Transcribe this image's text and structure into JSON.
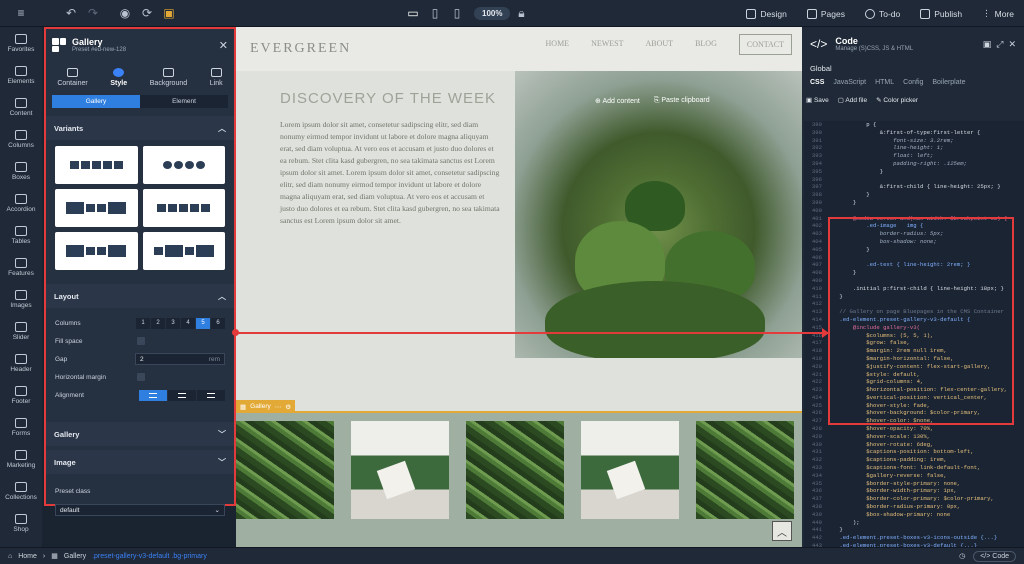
{
  "topbar": {
    "zoom": "100%",
    "buttons": [
      {
        "label": "Design",
        "icon": "palette-icon"
      },
      {
        "label": "Pages",
        "icon": "pages-icon"
      },
      {
        "label": "To-do",
        "icon": "check-circle-icon"
      },
      {
        "label": "Publish",
        "icon": "rocket-icon"
      },
      {
        "label": "More",
        "icon": "more-icon"
      }
    ]
  },
  "leftbar": {
    "items": [
      "Favorites",
      "Elements",
      "Content",
      "Columns",
      "Boxes",
      "Accordion",
      "Tables",
      "Features",
      "Images",
      "Slider",
      "Header",
      "Footer",
      "Forms",
      "Marketing",
      "Collections",
      "Shop"
    ]
  },
  "panel": {
    "title": "Gallery",
    "subtitle": "Preset #ed-new-128",
    "tabs": [
      "Container",
      "Style",
      "Background",
      "Link"
    ],
    "segments": [
      "Gallery",
      "Element"
    ],
    "sections": {
      "variants": "Variants",
      "layout": "Layout",
      "gallery": "Gallery",
      "image": "Image"
    },
    "layout": {
      "columns_label": "Columns",
      "columns": [
        "1",
        "2",
        "3",
        "4",
        "5",
        "6"
      ],
      "fill_space": "Fill space",
      "gap": "Gap",
      "gap_value": "2",
      "gap_unit": "rem",
      "horizontal_margin": "Horizontal margin",
      "alignment": "Alignment"
    },
    "preset_class_label": "Preset class",
    "preset_class_value": "default"
  },
  "site": {
    "brand": "EVERGREEN",
    "nav": [
      "HOME",
      "NEWEST",
      "ABOUT",
      "BLOG",
      "CONTACT"
    ],
    "hero_title": "DISCOVERY OF THE WEEK",
    "hero_body": "Lorem ipsum dolor sit amet, consetetur sadipscing elitr, sed diam nonumy eirmod tempor invidunt ut labore et dolore magna aliquyam erat, sed diam voluptua. At vero eos et accusam et justo duo dolores et ea rebum. Stet clita kasd gubergren, no sea takimata sanctus est Lorem ipsum dolor sit amet. Lorem ipsum dolor sit amet, consetetur sadipscing elitr, sed diam nonumy eirmod tempor invidunt ut labore et dolore magna aliquyam erat, sed diam voluptua. At vero eos et accusam et justo duo dolores et ea rebum. Stet clita kasd gubergren, no sea takimata sanctus est Lorem ipsum dolor sit amet.",
    "add_content": "Add content",
    "paste_clipboard": "Paste clipboard",
    "gallery_label": "Gallery"
  },
  "code": {
    "title": "Code",
    "subtitle": "Manage (S)CSS, JS & HTML",
    "global": "Global",
    "tabs": [
      "CSS",
      "JavaScript",
      "HTML",
      "Config",
      "Boilerplate"
    ],
    "tools": [
      "Save",
      "Add file",
      "Color picker"
    ],
    "lines": [
      {
        "n": "389",
        "t": "            p {"
      },
      {
        "n": "390",
        "t": "                &:first-of-type:first-letter {"
      },
      {
        "n": "391",
        "t": "                    font-size: 3.2rem;"
      },
      {
        "n": "392",
        "t": "                    line-height: 1;"
      },
      {
        "n": "393",
        "t": "                    float: left;"
      },
      {
        "n": "394",
        "t": "                    padding-right: .125em;"
      },
      {
        "n": "395",
        "t": "                }"
      },
      {
        "n": "396",
        "t": ""
      },
      {
        "n": "397",
        "t": "                &:first-child { line-height: 25px; }"
      },
      {
        "n": "398",
        "t": "            }"
      },
      {
        "n": "399",
        "t": "        }"
      },
      {
        "n": "400",
        "t": ""
      },
      {
        "n": "401",
        "t": "        @media screen and(max-width: $breakpoint-sm) {"
      },
      {
        "n": "402",
        "t": "            .ed-image   img {"
      },
      {
        "n": "403",
        "t": "                border-radius: 5px;"
      },
      {
        "n": "404",
        "t": "                box-shadow: none;"
      },
      {
        "n": "405",
        "t": "            }"
      },
      {
        "n": "406",
        "t": ""
      },
      {
        "n": "407",
        "t": "            .ed-text { line-height: 2rem; }"
      },
      {
        "n": "408",
        "t": "        }"
      },
      {
        "n": "409",
        "t": ""
      },
      {
        "n": "410",
        "t": "        .initial p:first-child { line-height: 18px; }"
      },
      {
        "n": "411",
        "t": "    }"
      },
      {
        "n": "412",
        "t": ""
      },
      {
        "n": "413",
        "t": "    // Gallery on page Bluepages in the CMS Container"
      },
      {
        "n": "414",
        "t": "    .ed-element.preset-gallery-v3-default {"
      },
      {
        "n": "415",
        "t": "        @include gallery-v3("
      },
      {
        "n": "416",
        "t": "            $columns: (5, 5, 1),"
      },
      {
        "n": "417",
        "t": "            $grow: false,"
      },
      {
        "n": "418",
        "t": "            $margin: 2rem null 1rem,"
      },
      {
        "n": "419",
        "t": "            $margin-horizontal: false,"
      },
      {
        "n": "420",
        "t": "            $justify-content: flex-start-gallery,"
      },
      {
        "n": "421",
        "t": "            $style: default,"
      },
      {
        "n": "422",
        "t": "            $grid-columns: 4,"
      },
      {
        "n": "423",
        "t": "            $horizontal-position: flex-center-gallery,"
      },
      {
        "n": "424",
        "t": "            $vertical-position: vertical_center,"
      },
      {
        "n": "425",
        "t": "            $hover-style: fade,"
      },
      {
        "n": "426",
        "t": "            $hover-background: $color-primary,"
      },
      {
        "n": "427",
        "t": "            $hover-color: $none,"
      },
      {
        "n": "428",
        "t": "            $hover-opacity: 70%,"
      },
      {
        "n": "429",
        "t": "            $hover-scale: 130%,"
      },
      {
        "n": "430",
        "t": "            $hover-rotate: 6deg,"
      },
      {
        "n": "431",
        "t": "            $captions-position: bottom-left,"
      },
      {
        "n": "432",
        "t": "            $captions-padding: 1rem,"
      },
      {
        "n": "433",
        "t": "            $captions-font: link-default-font,"
      },
      {
        "n": "434",
        "t": "            $gallery-reverse: false,"
      },
      {
        "n": "435",
        "t": "            $border-style-primary: none,"
      },
      {
        "n": "436",
        "t": "            $border-width-primary: 1px,"
      },
      {
        "n": "437",
        "t": "            $border-color-primary: $color-primary,"
      },
      {
        "n": "438",
        "t": "            $border-radius-primary: 0px,"
      },
      {
        "n": "439",
        "t": "            $box-shadow-primary: none"
      },
      {
        "n": "440",
        "t": "        );"
      },
      {
        "n": "441",
        "t": "    }"
      },
      {
        "n": "442",
        "t": "    .ed-element.preset-boxes-v3-icons-outside {...}"
      },
      {
        "n": "443",
        "t": "    .ed-element.preset-boxes-v3-default {...}"
      },
      {
        "n": "444",
        "t": "    .ed-element.preset-boxes-v3-... t {...}"
      }
    ]
  },
  "status": {
    "home": "Home",
    "gallery": "Gallery",
    "classes": ".preset-gallery-v3-default .bg-primary",
    "code_btn": "Code"
  },
  "colors": {
    "accent": "#2f7fe0",
    "highlight": "#e33b3b",
    "selection": "#e3a936"
  }
}
